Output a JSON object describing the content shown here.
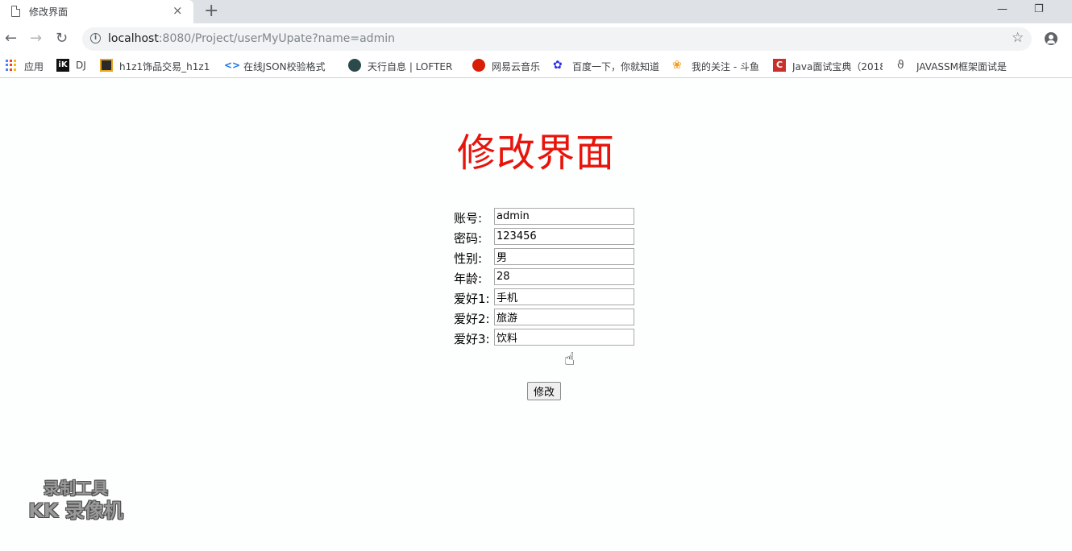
{
  "browser": {
    "tab": {
      "title": "修改界面",
      "close": "×"
    },
    "new_tab": "+",
    "window_controls": {
      "minimize": "—",
      "restore": "❐"
    },
    "nav": {
      "back": "←",
      "forward": "→",
      "reload": "↻"
    },
    "address_bar": {
      "host": "localhost",
      "rest": ":8080/Project/userMyUpate?name=admin"
    },
    "bookmarks": [
      {
        "label": "应用",
        "icon": "apps-grid-icon"
      },
      {
        "label": "DJ",
        "icon": "ik-icon"
      },
      {
        "label": "h1z1饰品交易_h1z1",
        "icon": "h1z1-icon"
      },
      {
        "label": "在线JSON校验格式",
        "icon": "json-icon"
      },
      {
        "label": "天行自息 | LOFTER",
        "icon": "lofter-icon"
      },
      {
        "label": "网易云音乐",
        "icon": "netease-music-icon"
      },
      {
        "label": "百度一下，你就知道",
        "icon": "baidu-paw-icon"
      },
      {
        "label": "我的关注 - 斗鱼",
        "icon": "douyu-icon"
      },
      {
        "label": "Java面试宝典（2018",
        "icon": "csdn-icon"
      },
      {
        "label": "JAVASSM框架面试是",
        "icon": "javassm-icon"
      }
    ]
  },
  "page": {
    "title": "修改界面",
    "form": {
      "fields": [
        {
          "label": "账号:",
          "value": "admin"
        },
        {
          "label": "密码:",
          "value": "123456"
        },
        {
          "label": "性别:",
          "value": "男"
        },
        {
          "label": "年龄:",
          "value": "28"
        },
        {
          "label": "爱好1:",
          "value": "手机"
        },
        {
          "label": "爱好2:",
          "value": "旅游"
        },
        {
          "label": "爱好3:",
          "value": "饮料"
        }
      ],
      "submit_label": "修改"
    }
  },
  "watermark": {
    "line1": "录制工具",
    "line2": "KK 录像机"
  },
  "colors": {
    "title": "#e8140c",
    "accent": "#4285f4"
  }
}
